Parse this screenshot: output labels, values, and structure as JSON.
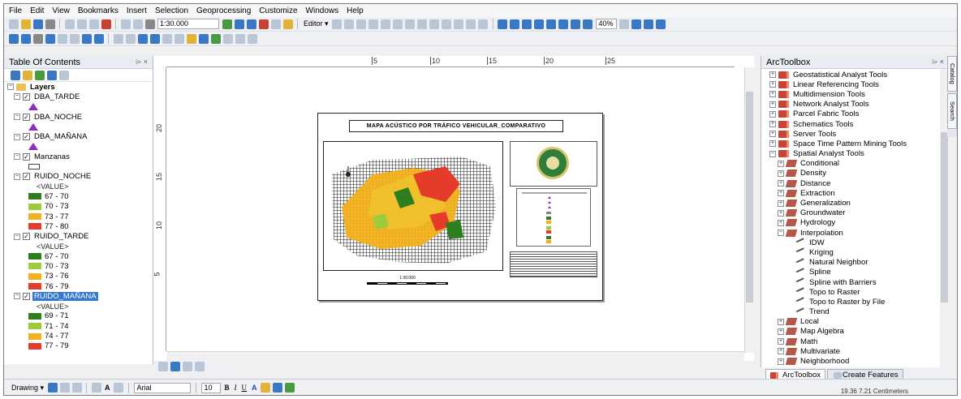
{
  "menu": [
    "File",
    "Edit",
    "View",
    "Bookmarks",
    "Insert",
    "Selection",
    "Geoprocessing",
    "Customize",
    "Windows",
    "Help"
  ],
  "toolbar": {
    "scale": "1:30.000",
    "editor": "Editor ▾",
    "zoom": "40%"
  },
  "toc": {
    "title": "Table Of Contents",
    "pin": "⌲ ×",
    "group": "Layers",
    "value_label": "<VALUE>",
    "layers": [
      {
        "name": "DBA_TARDE",
        "symbol": "triangle"
      },
      {
        "name": "DBA_NOCHE",
        "symbol": "triangle"
      },
      {
        "name": "DBA_MAÑANA",
        "symbol": "triangle"
      },
      {
        "name": "Manzanas",
        "symbol": "rect"
      }
    ],
    "rasters": [
      {
        "name": "RUIDO_NOCHE",
        "classes": [
          {
            "label": "67 - 70",
            "color": "#2e7d1f"
          },
          {
            "label": "70 - 73",
            "color": "#9ccc3b"
          },
          {
            "label": "73 - 77",
            "color": "#f3b21c"
          },
          {
            "label": "77 - 80",
            "color": "#e43b2b"
          }
        ]
      },
      {
        "name": "RUIDO_TARDE",
        "classes": [
          {
            "label": "67 - 70",
            "color": "#2e7d1f"
          },
          {
            "label": "70 - 73",
            "color": "#9ccc3b"
          },
          {
            "label": "73 - 76",
            "color": "#f3b21c"
          },
          {
            "label": "76 - 79",
            "color": "#e43b2b"
          }
        ]
      },
      {
        "name": "RUIDO_MAÑANA",
        "classes": [
          {
            "label": "69 - 71",
            "color": "#2e7d1f"
          },
          {
            "label": "71 - 74",
            "color": "#9ccc3b"
          },
          {
            "label": "74 - 77",
            "color": "#f3b21c"
          },
          {
            "label": "77 - 79",
            "color": "#e43b2b"
          }
        ]
      }
    ]
  },
  "layout": {
    "ruler_top": [
      "5",
      "10",
      "15",
      "20",
      "25"
    ],
    "ruler_left": [
      "20",
      "15",
      "10",
      "5"
    ],
    "map_title": "MAPA ACÚSTICO POR TRÁFICO VEHICULAR_COMPARATIVO",
    "scale_text": "1:30.000"
  },
  "arctoolbox": {
    "title": "ArcToolbox",
    "pin": "⌲ ×",
    "items": [
      {
        "label": "Geostatistical Analyst Tools",
        "level": 0,
        "type": "toolbox",
        "exp": "+"
      },
      {
        "label": "Linear Referencing Tools",
        "level": 0,
        "type": "toolbox",
        "exp": "+"
      },
      {
        "label": "Multidimension Tools",
        "level": 0,
        "type": "toolbox",
        "exp": "+"
      },
      {
        "label": "Network Analyst Tools",
        "level": 0,
        "type": "toolbox",
        "exp": "+"
      },
      {
        "label": "Parcel Fabric Tools",
        "level": 0,
        "type": "toolbox",
        "exp": "+"
      },
      {
        "label": "Schematics Tools",
        "level": 0,
        "type": "toolbox",
        "exp": "+"
      },
      {
        "label": "Server Tools",
        "level": 0,
        "type": "toolbox",
        "exp": "+"
      },
      {
        "label": "Space Time Pattern Mining Tools",
        "level": 0,
        "type": "toolbox",
        "exp": "+"
      },
      {
        "label": "Spatial Analyst Tools",
        "level": 0,
        "type": "toolbox",
        "exp": "−"
      },
      {
        "label": "Conditional",
        "level": 1,
        "type": "toolset",
        "exp": "+"
      },
      {
        "label": "Density",
        "level": 1,
        "type": "toolset",
        "exp": "+"
      },
      {
        "label": "Distance",
        "level": 1,
        "type": "toolset",
        "exp": "+"
      },
      {
        "label": "Extraction",
        "level": 1,
        "type": "toolset",
        "exp": "+"
      },
      {
        "label": "Generalization",
        "level": 1,
        "type": "toolset",
        "exp": "+"
      },
      {
        "label": "Groundwater",
        "level": 1,
        "type": "toolset",
        "exp": "+"
      },
      {
        "label": "Hydrology",
        "level": 1,
        "type": "toolset",
        "exp": "+"
      },
      {
        "label": "Interpolation",
        "level": 1,
        "type": "toolset",
        "exp": "−"
      },
      {
        "label": "IDW",
        "level": 2,
        "type": "tool",
        "exp": ""
      },
      {
        "label": "Kriging",
        "level": 2,
        "type": "tool",
        "exp": ""
      },
      {
        "label": "Natural Neighbor",
        "level": 2,
        "type": "tool",
        "exp": ""
      },
      {
        "label": "Spline",
        "level": 2,
        "type": "tool",
        "exp": ""
      },
      {
        "label": "Spline with Barriers",
        "level": 2,
        "type": "tool",
        "exp": ""
      },
      {
        "label": "Topo to Raster",
        "level": 2,
        "type": "tool",
        "exp": ""
      },
      {
        "label": "Topo to Raster by File",
        "level": 2,
        "type": "tool",
        "exp": ""
      },
      {
        "label": "Trend",
        "level": 2,
        "type": "tool",
        "exp": ""
      },
      {
        "label": "Local",
        "level": 1,
        "type": "toolset",
        "exp": "+"
      },
      {
        "label": "Map Algebra",
        "level": 1,
        "type": "toolset",
        "exp": "+"
      },
      {
        "label": "Math",
        "level": 1,
        "type": "toolset",
        "exp": "+"
      },
      {
        "label": "Multivariate",
        "level": 1,
        "type": "toolset",
        "exp": "+"
      },
      {
        "label": "Neighborhood",
        "level": 1,
        "type": "toolset",
        "exp": "+"
      }
    ],
    "tabs": [
      "ArcToolbox",
      "Create Features"
    ]
  },
  "side_tabs": [
    "Catalog",
    "Search"
  ],
  "drawing": {
    "label": "Drawing ▾",
    "font": "Arial",
    "size": "10",
    "bold": "B",
    "italic": "I",
    "underline": "U",
    "font_color": "A"
  },
  "status_bar": "19.36 7.21 Centimeters"
}
